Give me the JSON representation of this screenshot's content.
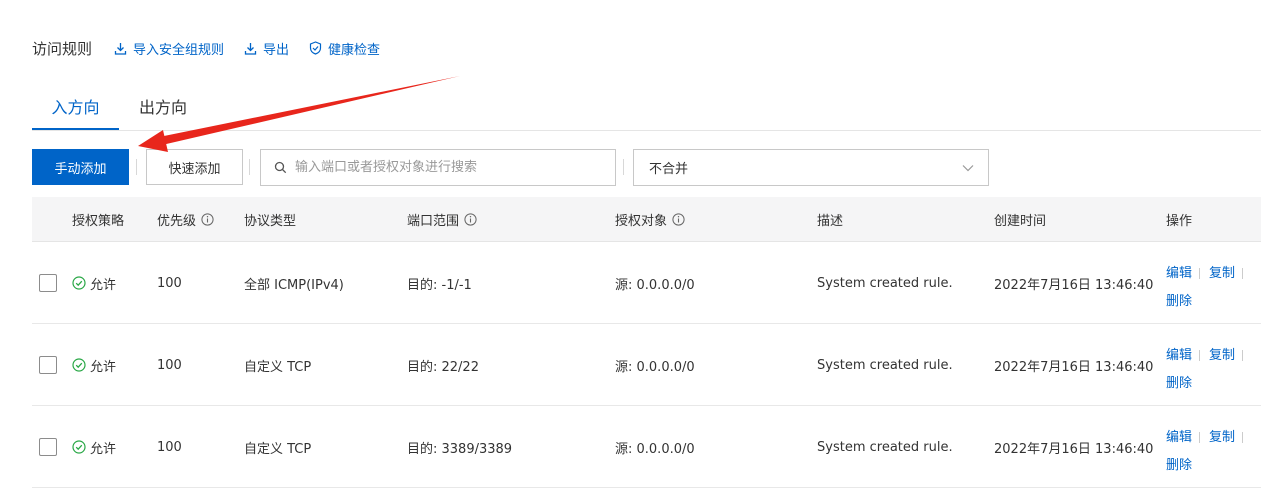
{
  "header": {
    "title": "访问规则",
    "links": [
      {
        "label": "导入安全组规则",
        "icon": "import-icon"
      },
      {
        "label": "导出",
        "icon": "export-icon"
      },
      {
        "label": "健康检查",
        "icon": "shield-check-icon"
      }
    ]
  },
  "tabs": [
    {
      "label": "入方向",
      "active": true
    },
    {
      "label": "出方向",
      "active": false
    }
  ],
  "toolbar": {
    "manual_add": "手动添加",
    "quick_add": "快速添加",
    "search_placeholder": "输入端口或者授权对象进行搜索",
    "merge_select": "不合并"
  },
  "columns": [
    "授权策略",
    "优先级",
    "协议类型",
    "端口范围",
    "授权对象",
    "描述",
    "创建时间",
    "操作"
  ],
  "rows": [
    {
      "policy": "允许",
      "priority": "100",
      "protocol": "全部 ICMP(IPv4)",
      "port": "目的: -1/-1",
      "source": "源: 0.0.0.0/0",
      "desc": "System created rule.",
      "created": "2022年7月16日 13:46:40"
    },
    {
      "policy": "允许",
      "priority": "100",
      "protocol": "自定义 TCP",
      "port": "目的: 22/22",
      "source": "源: 0.0.0.0/0",
      "desc": "System created rule.",
      "created": "2022年7月16日 13:46:40"
    },
    {
      "policy": "允许",
      "priority": "100",
      "protocol": "自定义 TCP",
      "port": "目的: 3389/3389",
      "source": "源: 0.0.0.0/0",
      "desc": "System created rule.",
      "created": "2022年7月16日 13:46:40"
    }
  ],
  "actions": {
    "edit": "编辑",
    "copy": "复制",
    "delete": "删除"
  },
  "colors": {
    "accent": "#0064c8",
    "annotation_arrow": "#e8261c",
    "allow_green": "#28a745"
  }
}
